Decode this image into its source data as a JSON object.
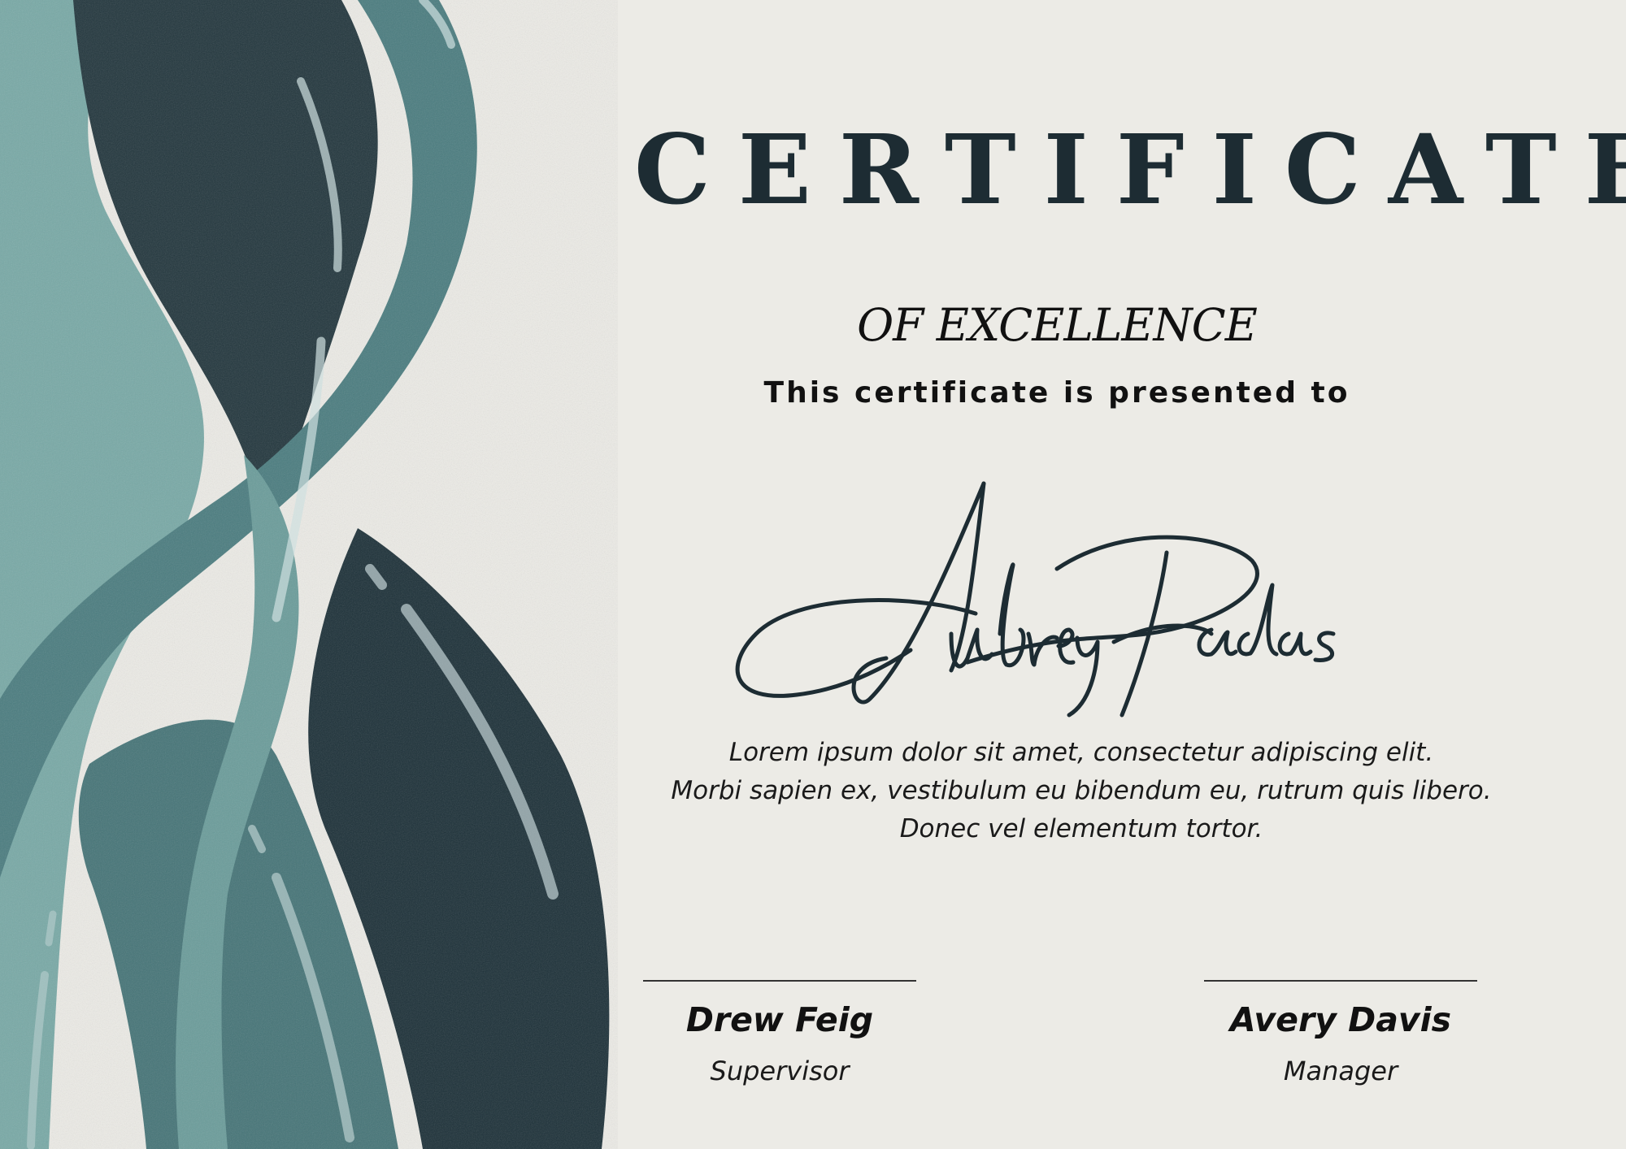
{
  "certificate": {
    "title": "CERTIFICATE",
    "subtitle": "OF EXCELLENCE",
    "presented_to": "This certificate is presented to",
    "recipient_name": "Aubrey Padas",
    "body_lines": [
      "Lorem ipsum dolor sit amet, consectetur adipiscing elit.",
      "Morbi sapien ex, vestibulum eu bibendum eu, rutrum quis libero.",
      "Donec vel elementum tortor."
    ]
  },
  "signatories": [
    {
      "name": "Drew Feig",
      "role": "Supervisor"
    },
    {
      "name": "Avery Davis",
      "role": "Manager"
    }
  ],
  "colors": {
    "paper": "#ecebe6",
    "ink": "#1d2c33",
    "teal_light": "#78a9a6",
    "teal_mid": "#4a7c7f",
    "teal_dark": "#1c3038"
  }
}
